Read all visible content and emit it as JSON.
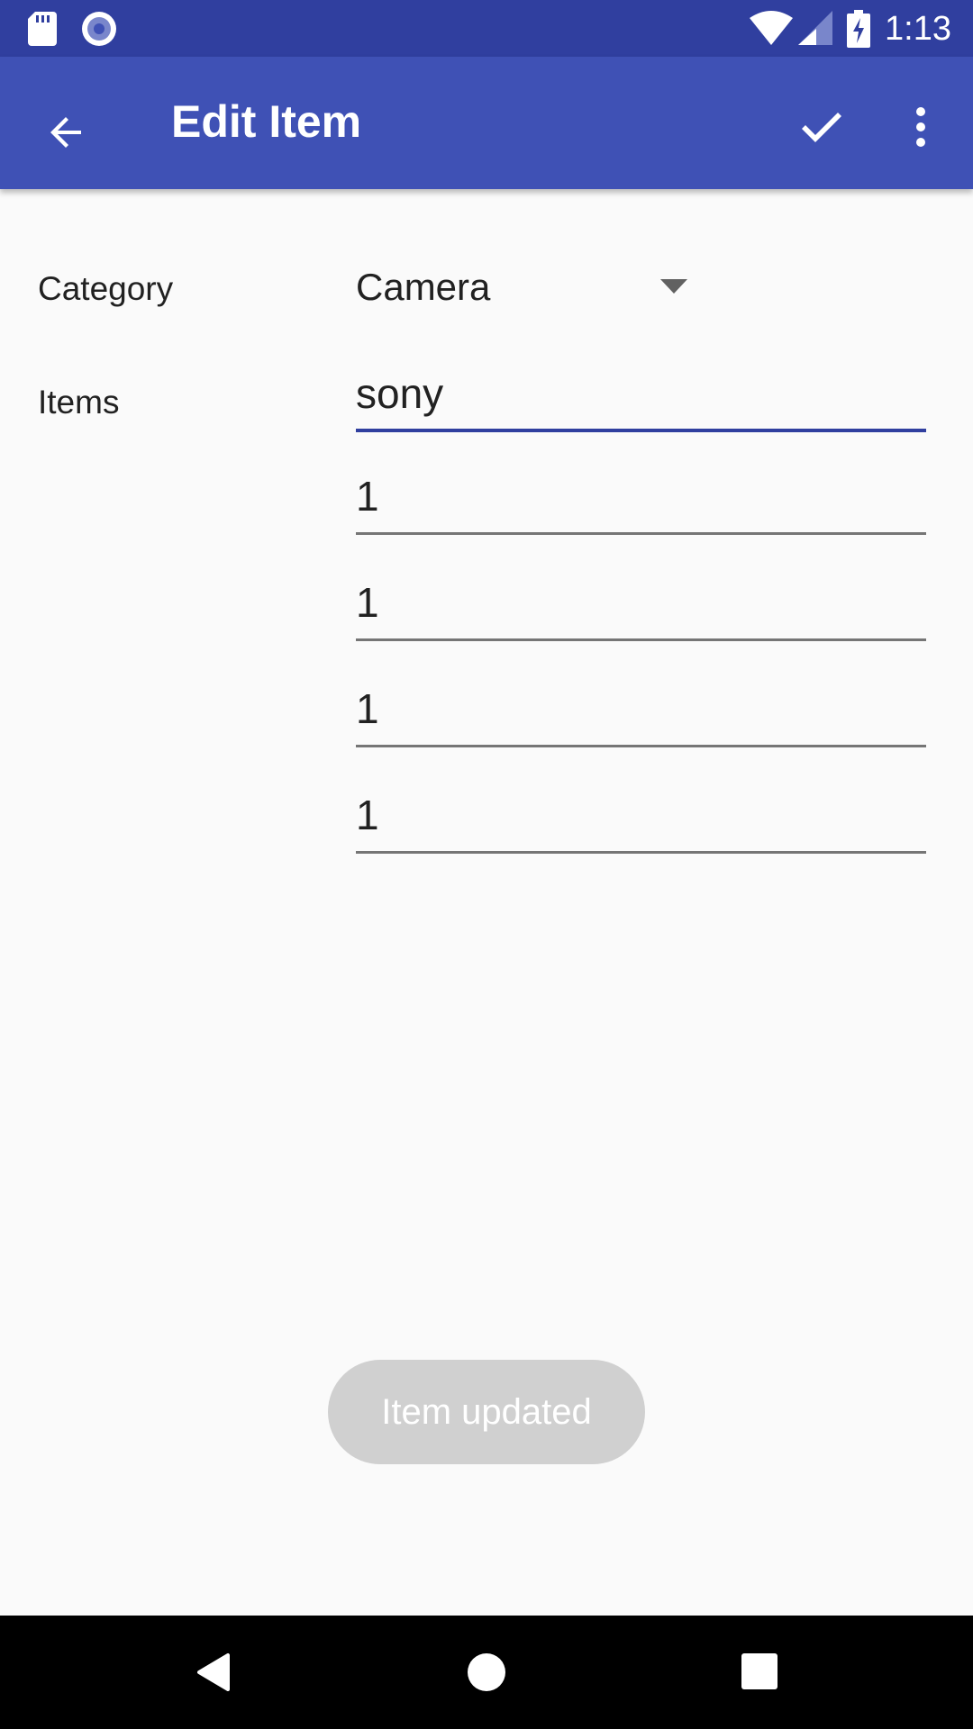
{
  "status_bar": {
    "time": "1:13",
    "icons": [
      "sd-card-icon",
      "record-circle-icon",
      "wifi-icon",
      "signal-icon",
      "battery-charging-icon"
    ]
  },
  "app_bar": {
    "title": "Edit Item",
    "back_icon": "arrow-back-icon",
    "save_icon": "check-icon",
    "overflow_icon": "more-vert-icon",
    "colors": {
      "primary": "#3f51b5",
      "primary_dark": "#303f9f"
    }
  },
  "form": {
    "category_label": "Category",
    "category_value": "Camera",
    "items_label": "Items",
    "items": [
      {
        "value": "sony",
        "focused": true
      },
      {
        "value": "1",
        "focused": false
      },
      {
        "value": "1",
        "focused": false
      },
      {
        "value": "1",
        "focused": false
      },
      {
        "value": "1",
        "focused": false
      }
    ]
  },
  "toast": {
    "text": "Item updated"
  },
  "nav_bar": {
    "icons": [
      "nav-back-icon",
      "nav-home-icon",
      "nav-recents-icon"
    ]
  }
}
